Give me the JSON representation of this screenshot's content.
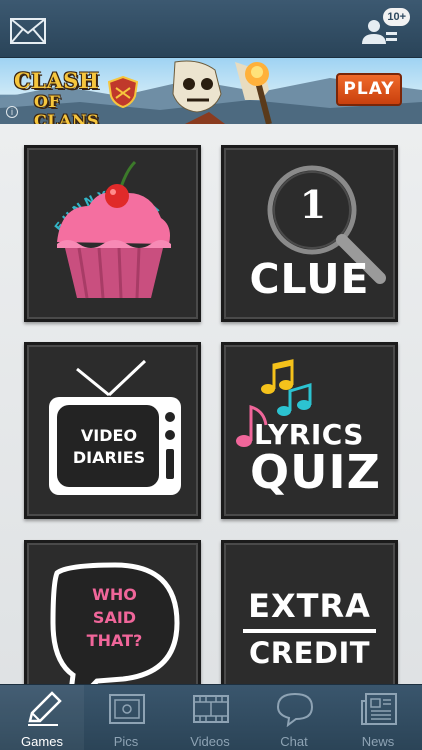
{
  "header": {
    "mail_icon": "envelope-icon",
    "friends_icon": "friends-icon",
    "friends_badge": "10+"
  },
  "ad": {
    "title_line1": "CLASH",
    "title_line2": "OF CLANS",
    "play_label": "PLAY",
    "info_label": "i"
  },
  "tiles": [
    {
      "name": "Funny Quiz",
      "art_text": "FUNNY QUIZ",
      "icon": "cupcake-icon"
    },
    {
      "name": "1 Clue",
      "number": "1",
      "word": "CLUE",
      "icon": "magnifier-icon"
    },
    {
      "name": "Video Diaries",
      "line1": "VIDEO",
      "line2": "DIARIES",
      "icon": "tv-icon"
    },
    {
      "name": "Lyrics Quiz",
      "line1": "LYRICS",
      "line2": "QUIZ",
      "icon": "music-notes-icon"
    },
    {
      "name": "Who Said That?",
      "line1": "WHO",
      "line2": "SAID",
      "line3": "THAT?",
      "icon": "speech-bubble-icon"
    },
    {
      "name": "Extra Credit",
      "line1": "EXTRA",
      "line2": "CREDIT"
    }
  ],
  "tabbar": {
    "active": "Games",
    "tabs": [
      {
        "label": "Games",
        "icon": "pencil-icon"
      },
      {
        "label": "Pics",
        "icon": "picture-icon"
      },
      {
        "label": "Videos",
        "icon": "film-icon"
      },
      {
        "label": "Chat",
        "icon": "chat-bubble-icon"
      },
      {
        "label": "News",
        "icon": "newspaper-icon"
      }
    ]
  },
  "colors": {
    "bar": "#2f4a60",
    "tile": "#2c2c2c",
    "accent_pink": "#f0669a",
    "play_orange": "#e35a1d"
  }
}
